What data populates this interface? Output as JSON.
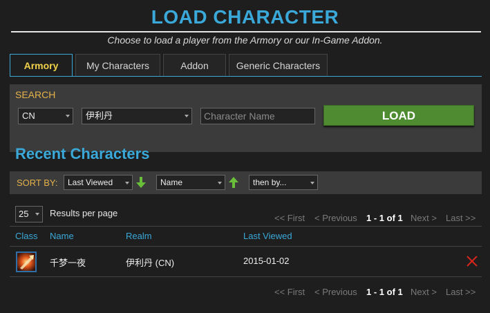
{
  "header": {
    "title": "LOAD CHARACTER",
    "subtitle": "Choose to load a player from the Armory or our In-Game Addon."
  },
  "tabs": [
    {
      "label": "Armory",
      "active": true
    },
    {
      "label": "My Characters",
      "active": false
    },
    {
      "label": "Addon",
      "active": false
    },
    {
      "label": "Generic Characters",
      "active": false
    }
  ],
  "search": {
    "label": "SEARCH",
    "region": "CN",
    "realm": "伊利丹",
    "character_placeholder": "Character Name",
    "load_label": "LOAD"
  },
  "recent": {
    "title": "Recent Characters",
    "sort_label": "SORT BY:",
    "sort_primary": "Last Viewed",
    "sort_secondary": "Name",
    "sort_tertiary": "then by...",
    "per_page_value": "25",
    "per_page_label": "Results per page",
    "pager": {
      "first": "<< First",
      "previous": "< Previous",
      "range": "1 - 1 of 1",
      "next": "Next >",
      "last": "Last >>"
    },
    "columns": {
      "class": "Class",
      "name": "Name",
      "realm": "Realm",
      "last_viewed": "Last Viewed"
    },
    "rows": [
      {
        "class_icon": "warrior-class-icon",
        "name": "千梦一夜",
        "realm": "伊利丹 (CN)",
        "last_viewed": "2015-01-02"
      }
    ]
  },
  "colors": {
    "accent_blue": "#3aa9d9",
    "label_gold": "#e5b24a",
    "load_green": "#4f8c31",
    "delete_red": "#d9261c"
  }
}
